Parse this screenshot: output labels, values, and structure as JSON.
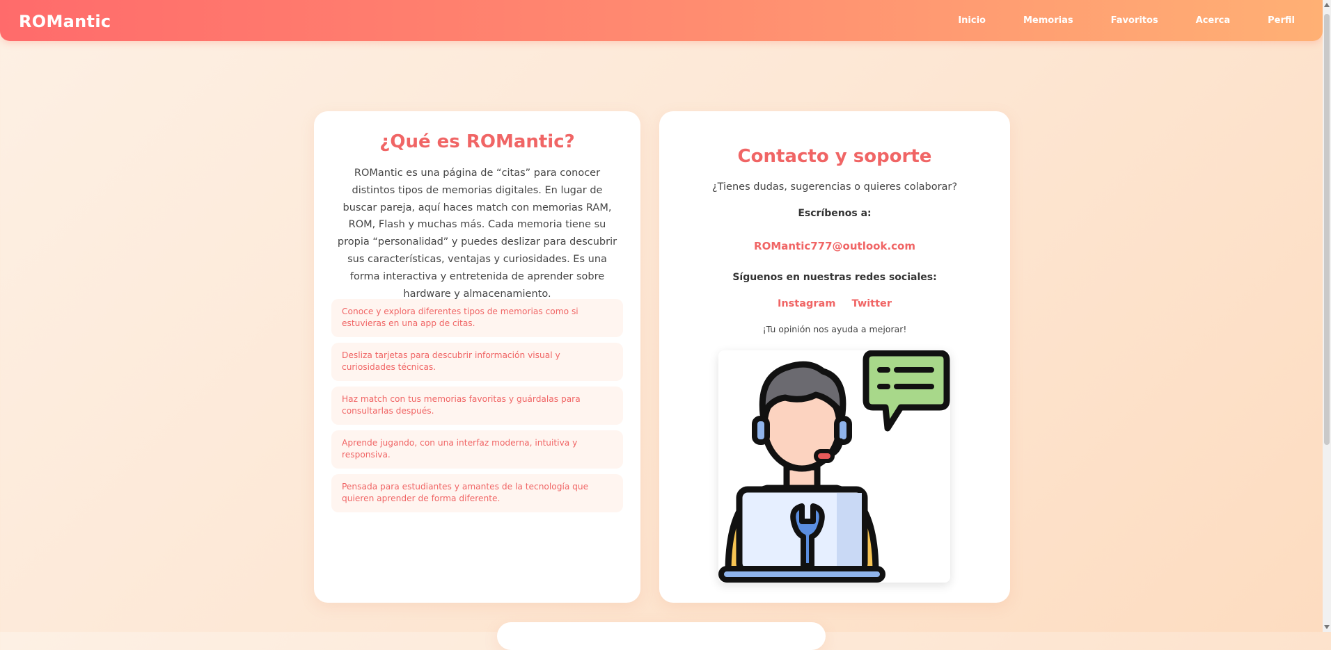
{
  "nav": {
    "brand": "ROMantic",
    "links": [
      "Inicio",
      "Memorias",
      "Favoritos",
      "Acerca",
      "Perfil"
    ]
  },
  "about": {
    "title": "¿Qué es ROMantic?",
    "text": "ROMantic es una página de “citas” para conocer distintos tipos de memorias digitales. En lugar de buscar pareja, aquí haces match con memorias RAM, ROM, Flash y muchas más. Cada memoria tiene su propia “personalidad” y puedes deslizar para descubrir sus características, ventajas y curiosidades. Es una forma interactiva y entretenida de aprender sobre hardware y almacenamiento.",
    "features": [
      "Conoce y explora diferentes tipos de memorias como si estuvieras en una app de citas.",
      "Desliza tarjetas para descubrir información visual y curiosidades técnicas.",
      "Haz match con tus memorias favoritas y guárdalas para consultarlas después.",
      "Aprende jugando, con una interfaz moderna, intuitiva y responsiva.",
      "Pensada para estudiantes y amantes de la tecnología que quieren aprender de forma diferente."
    ]
  },
  "contact": {
    "title": "Contacto y soporte",
    "question": "¿Tienes dudas, sugerencias o quieres colaborar?",
    "write_label": "Escríbenos a:",
    "email": "ROMantic777@outlook.com",
    "follow_label": "Síguenos en nuestras redes sociales:",
    "socials": [
      "Instagram",
      "Twitter"
    ],
    "opinion": "¡Tu opinión nos ayuda a mejorar!",
    "image_icon": "support-agent-icon"
  },
  "colors": {
    "accent": "#f06565",
    "nav_start": "#ff6b6b",
    "nav_end": "#ffb074",
    "feature_bg": "#fff5f0"
  }
}
